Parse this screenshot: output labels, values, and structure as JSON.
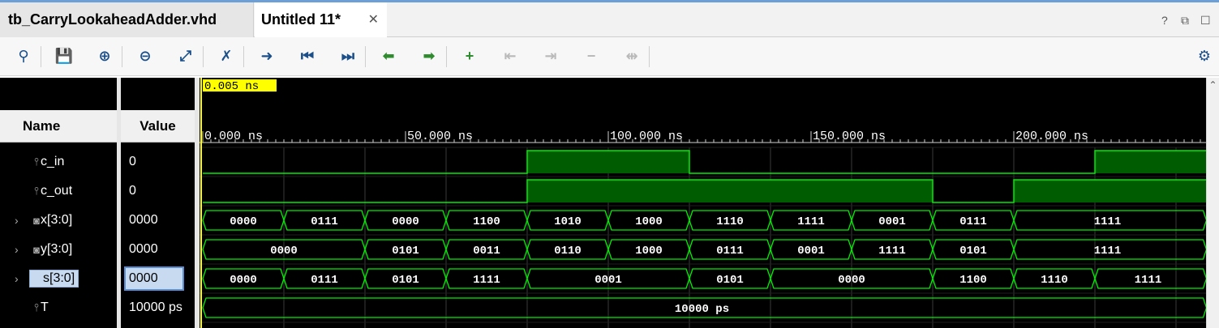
{
  "tabs": [
    {
      "label": "tb_CarryLookaheadAdder.vhd",
      "active": false
    },
    {
      "label": "Untitled 11*",
      "active": true
    }
  ],
  "window_controls": [
    "?",
    "⧉",
    "☐"
  ],
  "toolbar": {
    "buttons": [
      {
        "name": "search-icon",
        "glyph": "⚲",
        "enabled": true
      },
      {
        "name": "save-icon",
        "glyph": "💾",
        "enabled": true
      },
      {
        "name": "zoom-in-icon",
        "glyph": "⊕",
        "enabled": true
      },
      {
        "name": "zoom-out-icon",
        "glyph": "⊖",
        "enabled": true
      },
      {
        "name": "zoom-fit-icon",
        "glyph": "⤢",
        "enabled": true
      },
      {
        "name": "cursor-icon",
        "glyph": "✗",
        "enabled": true
      },
      {
        "name": "go-to-cursor-icon",
        "glyph": "➜",
        "enabled": true
      },
      {
        "name": "go-to-start-icon",
        "glyph": "⏮",
        "enabled": true
      },
      {
        "name": "go-to-end-icon",
        "glyph": "⏭",
        "enabled": true
      },
      {
        "name": "prev-transition-icon",
        "glyph": "⬅",
        "enabled": true
      },
      {
        "name": "next-transition-icon",
        "glyph": "➡",
        "enabled": true
      },
      {
        "name": "add-marker-icon",
        "glyph": "+",
        "enabled": true
      },
      {
        "name": "prev-marker-icon",
        "glyph": "⇤",
        "enabled": false
      },
      {
        "name": "next-marker-icon",
        "glyph": "⇥",
        "enabled": false
      },
      {
        "name": "delete-marker-icon",
        "glyph": "−",
        "enabled": false
      },
      {
        "name": "swap-cursors-icon",
        "glyph": "⇹",
        "enabled": false
      }
    ],
    "settings_icon": "⚙"
  },
  "columns": {
    "name": "Name",
    "value": "Value"
  },
  "cursor_label": "0.005 ns",
  "signals": [
    {
      "name": "c_in",
      "value": "0",
      "icon": "bit-signal-icon",
      "expandable": false,
      "selected": false
    },
    {
      "name": "c_out",
      "value": "0",
      "icon": "bit-signal-icon",
      "expandable": false,
      "selected": false
    },
    {
      "name": "x[3:0]",
      "value": "0000",
      "icon": "bus-signal-icon",
      "expandable": true,
      "selected": false
    },
    {
      "name": "y[3:0]",
      "value": "0000",
      "icon": "bus-signal-icon",
      "expandable": true,
      "selected": false
    },
    {
      "name": "s[3:0]",
      "value": "0000",
      "icon": "bus-signal-icon",
      "expandable": true,
      "selected": true
    },
    {
      "name": "T",
      "value": "10000 ps",
      "icon": "bit-signal-icon",
      "expandable": false,
      "selected": false
    }
  ],
  "timeline": {
    "start_ns": 0,
    "end_ns": 247.5,
    "major_tick_labels": [
      "0.000 ns",
      "50.000 ns",
      "100.000 ns",
      "150.000 ns",
      "200.000 ns"
    ],
    "major_tick_values_ns": [
      0,
      50,
      100,
      150,
      200
    ],
    "grid_step_ns": 20
  },
  "waveforms": {
    "c_in": [
      [
        0,
        80,
        "0"
      ],
      [
        80,
        120,
        "1"
      ],
      [
        120,
        220,
        "0"
      ],
      [
        220,
        247.5,
        "1"
      ]
    ],
    "c_out": [
      [
        0,
        80,
        "0"
      ],
      [
        80,
        180,
        "1"
      ],
      [
        180,
        200,
        "0"
      ],
      [
        200,
        247.5,
        "1"
      ]
    ],
    "x": [
      [
        0,
        20,
        "0000"
      ],
      [
        20,
        40,
        "0111"
      ],
      [
        40,
        60,
        "0000"
      ],
      [
        60,
        80,
        "1100"
      ],
      [
        80,
        100,
        "1010"
      ],
      [
        100,
        120,
        "1000"
      ],
      [
        120,
        140,
        "1110"
      ],
      [
        140,
        160,
        "1111"
      ],
      [
        160,
        180,
        "0001"
      ],
      [
        180,
        200,
        "0111"
      ],
      [
        200,
        247.5,
        "1111"
      ]
    ],
    "y": [
      [
        0,
        40,
        "0000"
      ],
      [
        40,
        60,
        "0101"
      ],
      [
        60,
        80,
        "0011"
      ],
      [
        80,
        100,
        "0110"
      ],
      [
        100,
        120,
        "1000"
      ],
      [
        120,
        140,
        "0111"
      ],
      [
        140,
        160,
        "0001"
      ],
      [
        160,
        180,
        "1111"
      ],
      [
        180,
        200,
        "0101"
      ],
      [
        200,
        247.5,
        "1111"
      ]
    ],
    "s": [
      [
        0,
        20,
        "0000"
      ],
      [
        20,
        40,
        "0111"
      ],
      [
        40,
        60,
        "0101"
      ],
      [
        60,
        80,
        "1111"
      ],
      [
        80,
        120,
        "0001"
      ],
      [
        120,
        140,
        "0101"
      ],
      [
        140,
        180,
        "0000"
      ],
      [
        180,
        200,
        "1100"
      ],
      [
        200,
        220,
        "1110"
      ],
      [
        220,
        247.5,
        "1111"
      ]
    ],
    "T": [
      [
        0,
        247.5,
        "10000 ps"
      ]
    ]
  },
  "colors": {
    "wave": "#00ee00",
    "high_fill": "#005c00",
    "cursor": "#ffff00",
    "grid": "#3a3a3a",
    "background": "#000000"
  }
}
